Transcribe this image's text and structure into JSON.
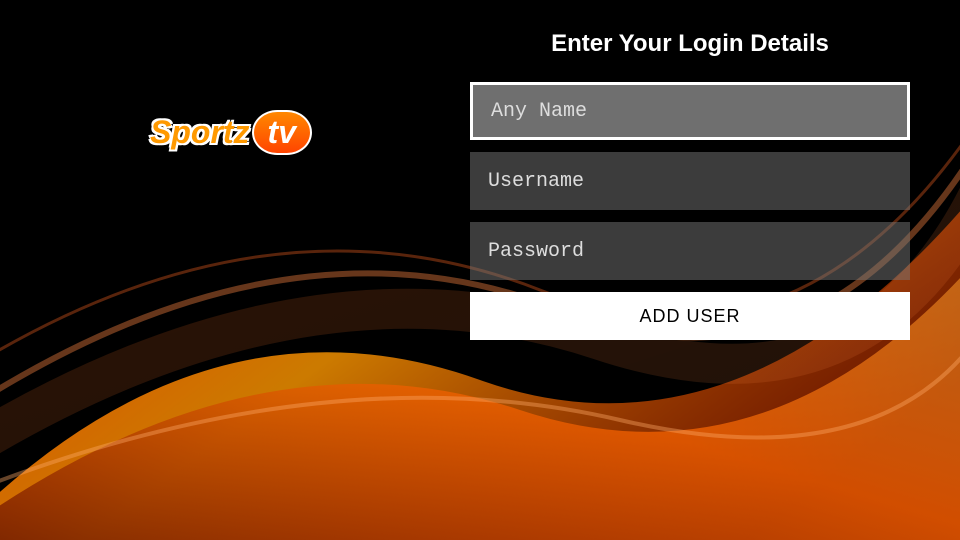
{
  "header": {
    "title": "Enter Your Login Details"
  },
  "logo": {
    "text_primary": "Sportz",
    "text_secondary": "tv"
  },
  "form": {
    "fields": {
      "name": {
        "placeholder": "Any Name",
        "value": ""
      },
      "username": {
        "placeholder": "Username",
        "value": ""
      },
      "password": {
        "placeholder": "Password",
        "value": ""
      }
    },
    "submit_label": "ADD USER"
  },
  "colors": {
    "accent": "#ff6600",
    "accent_light": "#ff9900",
    "bg": "#000000"
  }
}
